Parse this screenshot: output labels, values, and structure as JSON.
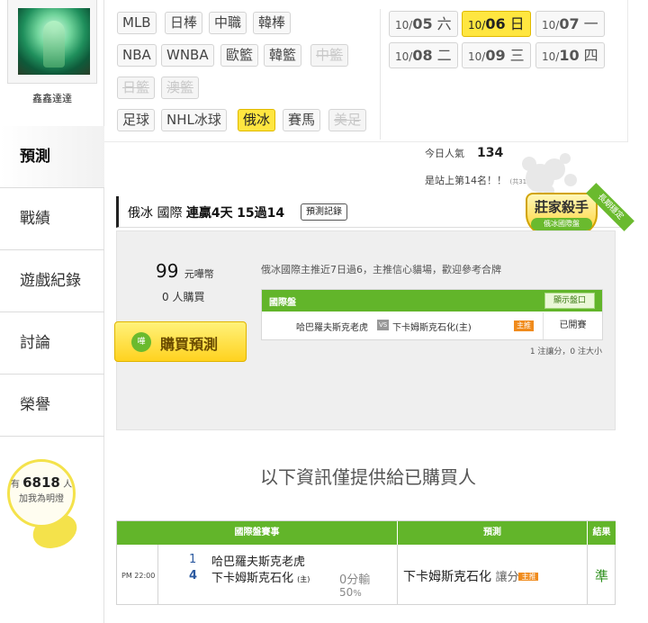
{
  "user": {
    "name": "鑫鑫達達"
  },
  "sidebar": {
    "items": [
      {
        "label": "預測",
        "active": true
      },
      {
        "label": "戰績"
      },
      {
        "label": "遊戲紀錄"
      },
      {
        "label": "討論"
      },
      {
        "label": "榮譽"
      }
    ],
    "lamp": {
      "prefix": "有",
      "count": "6818",
      "suffix": "人",
      "line2": "加我為明燈"
    }
  },
  "leagues": {
    "row1": [
      "MLB",
      "日棒",
      "中職",
      "韓棒"
    ],
    "row2": [
      "NBA",
      "WNBA",
      "歐籃",
      "韓籃",
      "中籃"
    ],
    "row3": [
      "日籃",
      "澳籃"
    ],
    "row4": [
      "足球",
      "NHL冰球",
      "俄冰",
      "賽馬",
      "美足"
    ],
    "active": "俄冰",
    "disabled": [
      "中籃",
      "日籃",
      "澳籃",
      "美足"
    ]
  },
  "dates": {
    "items": [
      {
        "month": "10/",
        "day": "05",
        "dow": "六"
      },
      {
        "month": "10/",
        "day": "06",
        "dow": "日",
        "active": true
      },
      {
        "month": "10/",
        "day": "07",
        "dow": "一"
      },
      {
        "month": "10/",
        "day": "08",
        "dow": "二"
      },
      {
        "month": "10/",
        "day": "09",
        "dow": "三"
      },
      {
        "month": "10/",
        "day": "10",
        "dow": "四"
      }
    ]
  },
  "stats": {
    "popularity_label": "今日人氣",
    "popularity": "134",
    "rank_text": "是站上第14名！！",
    "rank_total": "(共3189人)"
  },
  "prediction": {
    "sport": "俄冰",
    "market": "國際",
    "streak": "連贏4天",
    "record": "15過14",
    "record_button": "預測記錄",
    "badge_title": "莊家殺手",
    "badge_sub": "俄冰國際盤",
    "ribbon": "長期穩定",
    "price": "99",
    "price_unit": "元嘩幣",
    "buyers": "0",
    "buyers_unit": "人購買",
    "buy_button": "購買預測",
    "buy_icon": "嘩",
    "description": "俄冰國際主推近7日過6，主推信心貓場，歡迎參考合牌",
    "market_table": {
      "title": "國際盤",
      "show_button": "顯示盤口",
      "home": "哈巴羅夫斯克老虎",
      "vs": "VS",
      "away": "下卡姆斯克石化(主)",
      "tag": "主推",
      "status": "已開賽"
    },
    "note": "1 注讓分，0 注大小"
  },
  "info_line": "以下資訊僅提供給已購買人",
  "results": {
    "headers": [
      "國際盤賽事",
      "預測",
      "結果"
    ],
    "time": "PM 22:00",
    "rot1": "1",
    "rot2": "4",
    "team1": "哈巴羅夫斯克老虎",
    "team2": "下卡姆斯克石化",
    "team2_tag": "(主)",
    "line": "0分輸",
    "pct": "50",
    "pct_unit": "%",
    "pick": "下卡姆斯克石化",
    "pick_type": "讓分",
    "pick_tag": "主推",
    "result": "準"
  }
}
